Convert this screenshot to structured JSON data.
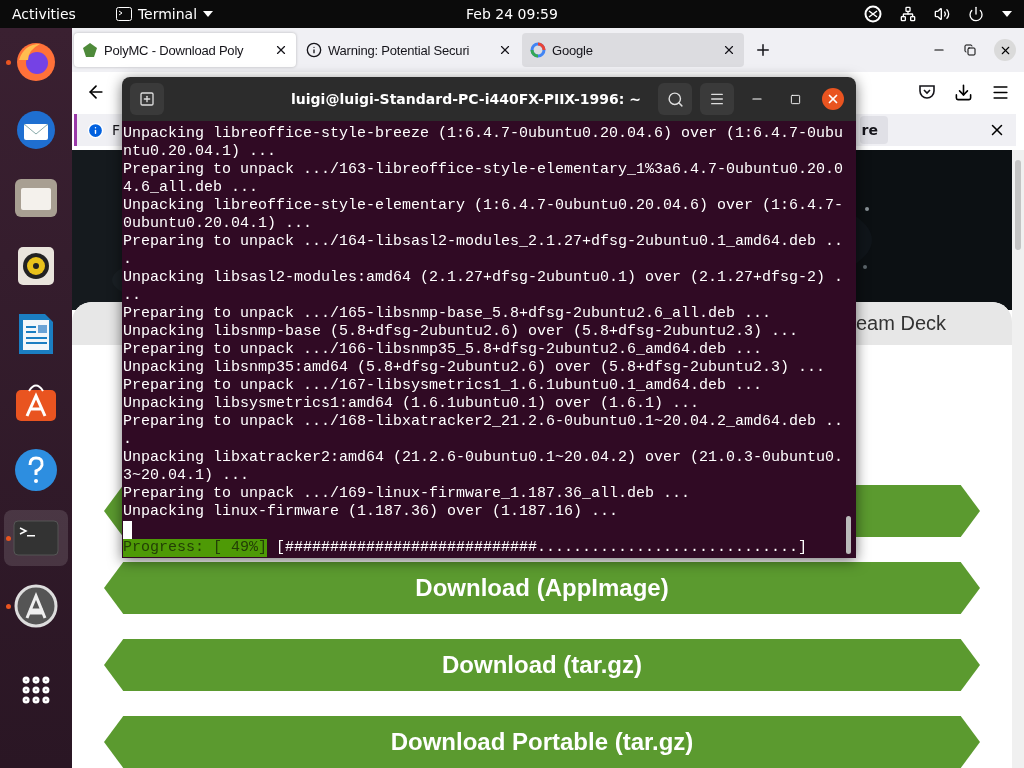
{
  "top_bar": {
    "activities": "Activities",
    "app_menu": "Terminal",
    "clock": "Feb 24  09:59"
  },
  "dock": {
    "items": [
      {
        "running": true,
        "selected": false
      },
      {
        "running": false,
        "selected": false
      },
      {
        "running": false,
        "selected": false
      },
      {
        "running": false,
        "selected": false
      },
      {
        "running": false,
        "selected": false
      },
      {
        "running": false,
        "selected": false
      },
      {
        "running": false,
        "selected": false
      },
      {
        "running": true,
        "selected": true
      },
      {
        "running": true,
        "selected": false
      },
      {
        "running": false,
        "selected": false
      }
    ]
  },
  "browser": {
    "tabs": [
      {
        "title": "PolyMC - Download Poly",
        "selected": true,
        "kind": "site"
      },
      {
        "title": "Warning: Potential Securi",
        "selected": false,
        "kind": "warning"
      },
      {
        "title": "Google",
        "selected": false,
        "kind": "google"
      }
    ],
    "notification": {
      "text": "F",
      "button": "re"
    },
    "page": {
      "tab_label": "eam Deck",
      "buttons": [
        {
          "label": "Download (AppImage)"
        },
        {
          "label": "Download (tar.gz)"
        },
        {
          "label": "Download Portable (tar.gz)"
        }
      ]
    }
  },
  "terminal": {
    "title": "luigi@luigi-Standard-PC-i440FX-PIIX-1996: ~",
    "lines": [
      "Unpacking libreoffice-style-breeze (1:6.4.7-0ubuntu0.20.04.6) over (1:6.4.7-0ubu",
      "ntu0.20.04.1) ...",
      "Preparing to unpack .../163-libreoffice-style-elementary_1%3a6.4.7-0ubuntu0.20.0",
      "4.6_all.deb ...",
      "Unpacking libreoffice-style-elementary (1:6.4.7-0ubuntu0.20.04.6) over (1:6.4.7-",
      "0ubuntu0.20.04.1) ...",
      "Preparing to unpack .../164-libsasl2-modules_2.1.27+dfsg-2ubuntu0.1_amd64.deb ..",
      ".",
      "Unpacking libsasl2-modules:amd64 (2.1.27+dfsg-2ubuntu0.1) over (2.1.27+dfsg-2) .",
      "..",
      "Preparing to unpack .../165-libsnmp-base_5.8+dfsg-2ubuntu2.6_all.deb ...",
      "Unpacking libsnmp-base (5.8+dfsg-2ubuntu2.6) over (5.8+dfsg-2ubuntu2.3) ...",
      "Preparing to unpack .../166-libsnmp35_5.8+dfsg-2ubuntu2.6_amd64.deb ...",
      "Unpacking libsnmp35:amd64 (5.8+dfsg-2ubuntu2.6) over (5.8+dfsg-2ubuntu2.3) ...",
      "Preparing to unpack .../167-libsysmetrics1_1.6.1ubuntu0.1_amd64.deb ...",
      "Unpacking libsysmetrics1:amd64 (1.6.1ubuntu0.1) over (1.6.1) ...",
      "Preparing to unpack .../168-libxatracker2_21.2.6-0ubuntu0.1~20.04.2_amd64.deb ..",
      ".",
      "Unpacking libxatracker2:amd64 (21.2.6-0ubuntu0.1~20.04.2) over (21.0.3-0ubuntu0.",
      "3~20.04.1) ...",
      "Preparing to unpack .../169-linux-firmware_1.187.36_all.deb ...",
      "Unpacking linux-firmware (1.187.36) over (1.187.16) ..."
    ],
    "progress": {
      "label": "Progress: [ 49%]",
      "bar": "[############################.............................]"
    }
  }
}
